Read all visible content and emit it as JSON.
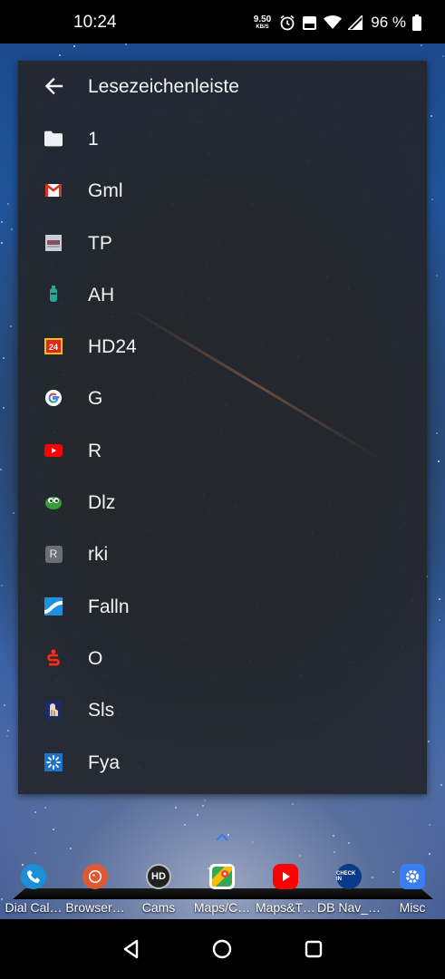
{
  "status_bar": {
    "time": "10:24",
    "net_speed_value": "9.50",
    "net_speed_unit": "KB/S",
    "battery_percent": "96 %"
  },
  "bookmarks_panel": {
    "title": "Lesezeichenleiste",
    "items": [
      {
        "label": "1",
        "icon": "folder-icon"
      },
      {
        "label": "Gml",
        "icon": "gmail-icon"
      },
      {
        "label": "TP",
        "icon": "tp-site-icon"
      },
      {
        "label": "AH",
        "icon": "ah-site-icon"
      },
      {
        "label": "HD24",
        "icon": "hd24-icon"
      },
      {
        "label": "G",
        "icon": "google-icon"
      },
      {
        "label": "R",
        "icon": "youtube-icon"
      },
      {
        "label": "Dlz",
        "icon": "dlz-site-icon"
      },
      {
        "label": "rki",
        "icon": "rki-letter-icon",
        "glyph": "R"
      },
      {
        "label": "Falln",
        "icon": "falln-site-icon"
      },
      {
        "label": "O",
        "icon": "sparkasse-icon"
      },
      {
        "label": "Sls",
        "icon": "sls-site-icon"
      },
      {
        "label": "Fya",
        "icon": "fya-site-icon"
      }
    ]
  },
  "dock": {
    "apps": [
      {
        "label": "Dial Cal…",
        "icon": "phone-icon"
      },
      {
        "label": "Browser…",
        "icon": "duckduckgo-icon"
      },
      {
        "label": "Cams",
        "icon": "camera-hd-icon",
        "glyph": "HD"
      },
      {
        "label": "Maps/C…",
        "icon": "google-maps-icon"
      },
      {
        "label": "Maps&T…",
        "icon": "youtube-icon"
      },
      {
        "label": "DB Nav_…",
        "icon": "db-navigator-icon",
        "glyph": "CHECK IN"
      },
      {
        "label": "Misc",
        "icon": "settings-icon"
      }
    ]
  },
  "colors": {
    "panel_bg": "#24272c",
    "text": "#f2f2f2",
    "accent_chevron": "#3b7bf0"
  }
}
